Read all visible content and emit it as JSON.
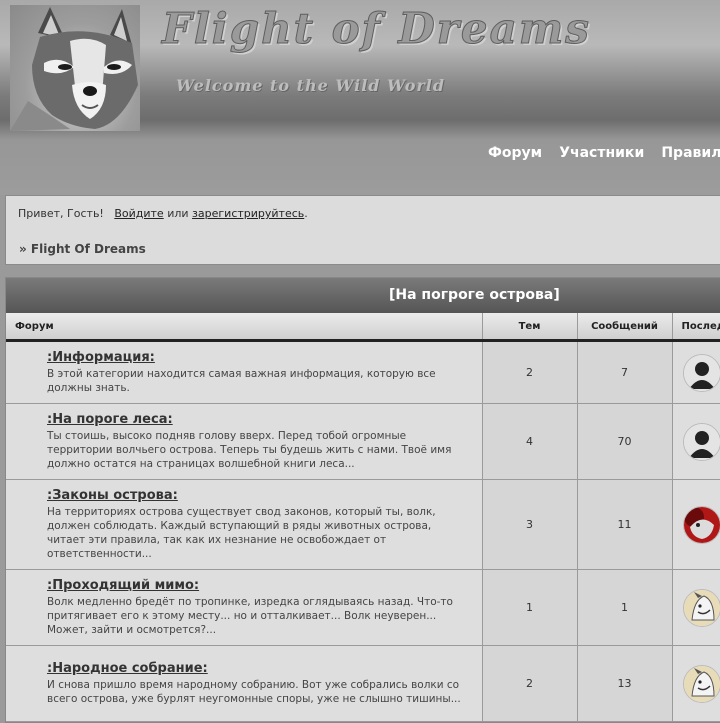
{
  "header": {
    "title": "Flight of Dreams",
    "slogan": "Welcome to the Wild World",
    "nav": [
      "Форум",
      "Участники",
      "Правила"
    ]
  },
  "info": {
    "greeting": "Привет, Гость!",
    "login": "Войдите",
    "or": "или",
    "register": "зарегистрируйтесь",
    "period": ".",
    "breadcrumb": "» Flight Of Dreams"
  },
  "category": {
    "title": "[На погроге острова]",
    "columns": [
      "Форум",
      "Тем",
      "Сообщений",
      "Последнее сообщение"
    ]
  },
  "forums": [
    {
      "title": ":Информация:",
      "desc": "В этой категории находится самая важная информация, которую все должны знать.",
      "topics": "2",
      "posts": "7",
      "avatar": "silhouette-icon"
    },
    {
      "title": ":На пороге леса:",
      "desc": "Ты стоишь, высоко подняв голову вверх. Перед тобой огромные территории волчьего острова. Теперь ты будешь жить с нами. Твоё имя должно остатся на страницах волшебной книги леса...",
      "topics": "4",
      "posts": "70",
      "avatar": "silhouette-icon"
    },
    {
      "title": ":Законы острова:",
      "desc": "На территориях острова существует свод законов, который ты, волк, должен соблюдать. Каждый вступающий в ряды животных острова, читает эти правила, так как их незнание не освобождает от ответственности...",
      "topics": "3",
      "posts": "11",
      "avatar": "red-wolf-icon"
    },
    {
      "title": ":Проходящий мимо:",
      "desc": "Волк медленно бредёт по тропинке, изредка оглядываясь назад. Что-то притягивает его к этому месту... но и отталкивает... Волк неуверен... Может, зайти и осмотрется?...",
      "topics": "1",
      "posts": "1",
      "avatar": "white-wolf-icon"
    },
    {
      "title": ":Народное собрание:",
      "desc": "И снова пришло время народному собранию. Вот уже собрались волки со всего острова, уже бурлят неугомонные споры, уже не слышно тишины...",
      "topics": "2",
      "posts": "13",
      "avatar": "white-wolf-icon"
    }
  ]
}
